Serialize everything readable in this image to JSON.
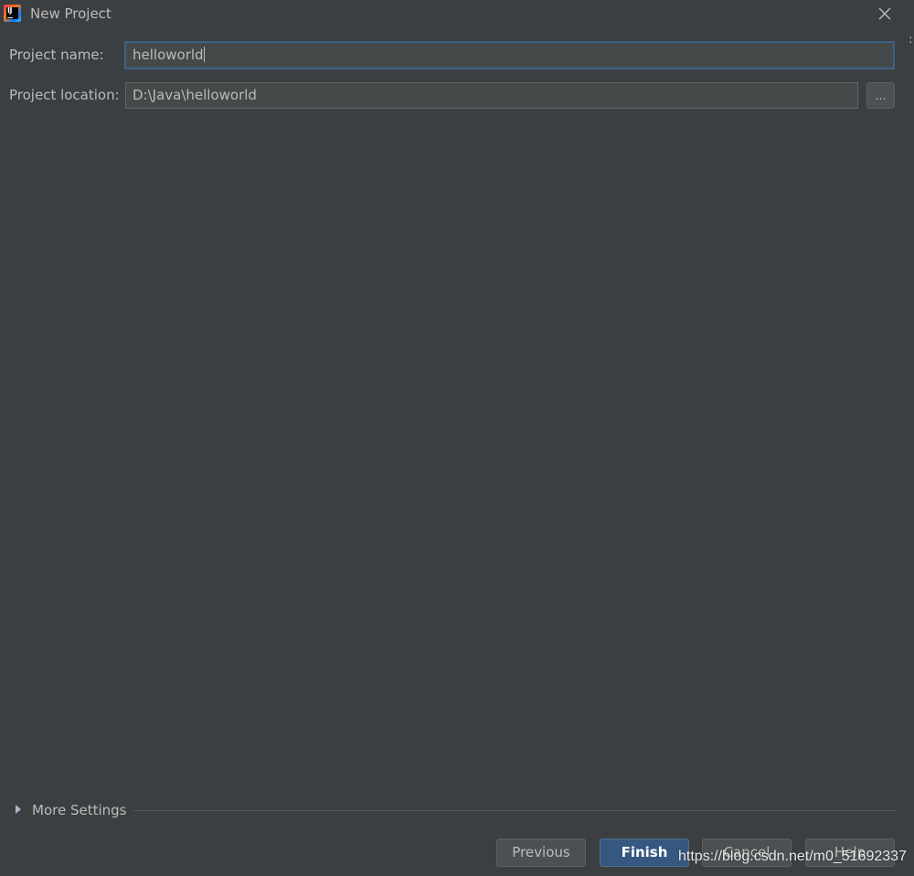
{
  "window": {
    "title": "New Project",
    "app_icon_text": "IJ"
  },
  "form": {
    "project_name_label": "Project name:",
    "project_name_value": "helloworld",
    "project_location_label": "Project location:",
    "project_location_value": "D:\\Java\\helloworld",
    "browse_label": "..."
  },
  "more_settings": {
    "label": "More Settings",
    "expanded": false
  },
  "footer": {
    "previous_label": "Previous",
    "finish_label": "Finish",
    "cancel_label": "Cancel",
    "help_label": "Help"
  },
  "watermark": {
    "text": "https://blog.csdn.net/m0_51692337"
  },
  "colors": {
    "background": "#3c3f41",
    "field_background": "#45494a",
    "focus_border": "#3d6185",
    "primary_button": "#365880",
    "text": "#bbbbbb"
  }
}
